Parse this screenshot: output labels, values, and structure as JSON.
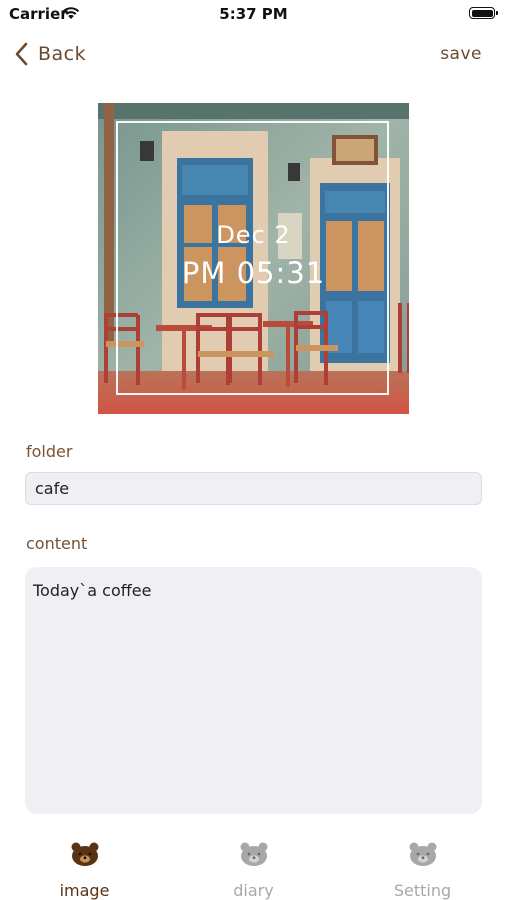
{
  "status_bar": {
    "carrier": "Carrier",
    "time": "5:37 PM"
  },
  "nav": {
    "back_label": "Back",
    "save_label": "save"
  },
  "photo": {
    "date": "Dec 2",
    "time": "PM 05:31"
  },
  "form": {
    "folder_label": "folder",
    "folder_value": "cafe",
    "content_label": "content",
    "content_value": "Today`a coffee"
  },
  "tab_bar": {
    "tabs": [
      {
        "label": "image",
        "active": true,
        "icon": "bear-icon"
      },
      {
        "label": "diary",
        "active": false,
        "icon": "bear-icon"
      },
      {
        "label": "Setting",
        "active": false,
        "icon": "bear-icon"
      }
    ],
    "active_color": "#5a3214",
    "inactive_color": "#a8a8a8"
  },
  "colors": {
    "accent": "#6b4a2f",
    "field_bg": "#efeff4"
  }
}
